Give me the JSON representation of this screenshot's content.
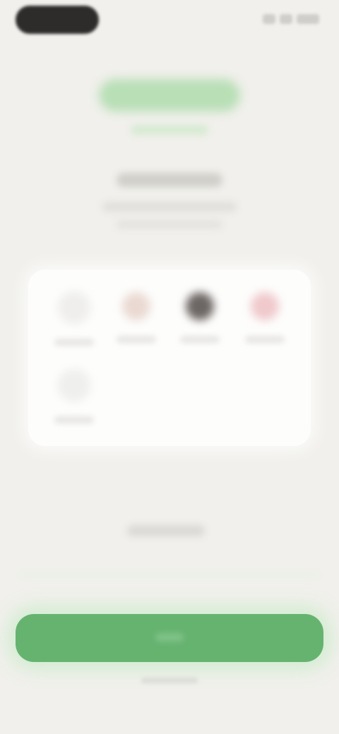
{
  "colors": {
    "background": "#f1f0ec",
    "accent": "#66b370",
    "brand_light": "#b8dfb6",
    "card": "#fdfdfc"
  },
  "options": [
    {
      "icon": "empty-circle-icon",
      "color": "#efeeec"
    },
    {
      "icon": "beige-swatch-icon",
      "color": "#ead9d2"
    },
    {
      "icon": "dark-swatch-icon",
      "color": "#6c6664"
    },
    {
      "icon": "pink-swatch-icon",
      "color": "#f0c9cc"
    },
    {
      "icon": "empty-circle-icon",
      "color": "#efefed"
    }
  ]
}
